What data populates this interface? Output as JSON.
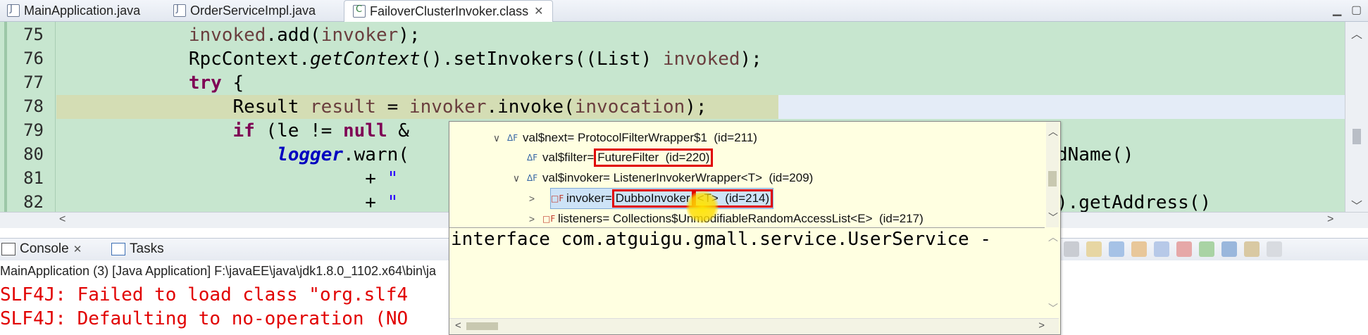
{
  "editor_tabs": [
    {
      "label": "MainApplication.java",
      "active": false
    },
    {
      "label": "OrderServiceImpl.java",
      "active": false
    },
    {
      "label": "FailoverClusterInvoker.class",
      "active": true
    }
  ],
  "code_lines": [
    {
      "num": "75",
      "text": "            invoked.add(invoker);"
    },
    {
      "num": "76",
      "text": "            RpcContext.getContext().setInvokers((List) invoked);"
    },
    {
      "num": "77",
      "text": "            try {"
    },
    {
      "num": "78",
      "text": "                Result result = invoker.invoke(invocation);"
    },
    {
      "num": "79",
      "text": "                if (le != null &"
    },
    {
      "num": "80",
      "text": "                    logger.warn("
    },
    {
      "num": "81",
      "text": "                            + \""
    },
    {
      "num": "82",
      "text": "                            + \""
    }
  ],
  "code_right_fragments": {
    "line80": "dName()",
    "line82": ").getAddress()"
  },
  "popup": {
    "nodes": [
      {
        "name": "val$next",
        "value": "ProtocolFilterWrapper$1",
        "id": "(id=211)",
        "expanded": true
      },
      {
        "name": "val$filter",
        "value": "FutureFilter",
        "id": "(id=220)",
        "expanded": false
      },
      {
        "name": "val$invoker",
        "value": "ListenerInvokerWrapper<T>",
        "id": "(id=209)",
        "expanded": true
      },
      {
        "name": "invoker",
        "value": "DubboInvoker",
        "generic": "<T>",
        "id": "(id=214)",
        "expanded": false
      },
      {
        "name": "listeners",
        "value": "Collections$UnmodifiableRandomAccessList<E>",
        "id": "(id=217)",
        "expanded": false
      }
    ],
    "detail_text": "interface com.atguigu.gmall.service.UserService -"
  },
  "console": {
    "tabs": [
      {
        "label": "Console",
        "active": true
      },
      {
        "label": "Tasks",
        "active": false
      }
    ],
    "launch_path": "MainApplication (3) [Java Application] F:\\javaEE\\java\\jdk1.8.0_1102.x64\\bin\\ja",
    "output_lines": [
      "SLF4J: Failed to load class \"org.slf4",
      "SLF4J: Defaulting to no-operation (NO"
    ]
  },
  "colors": {
    "editor_bg": "#c7e6cf",
    "popup_bg": "#ffffe1",
    "error_text": "#e10000",
    "highlight_box": "#e00000"
  }
}
